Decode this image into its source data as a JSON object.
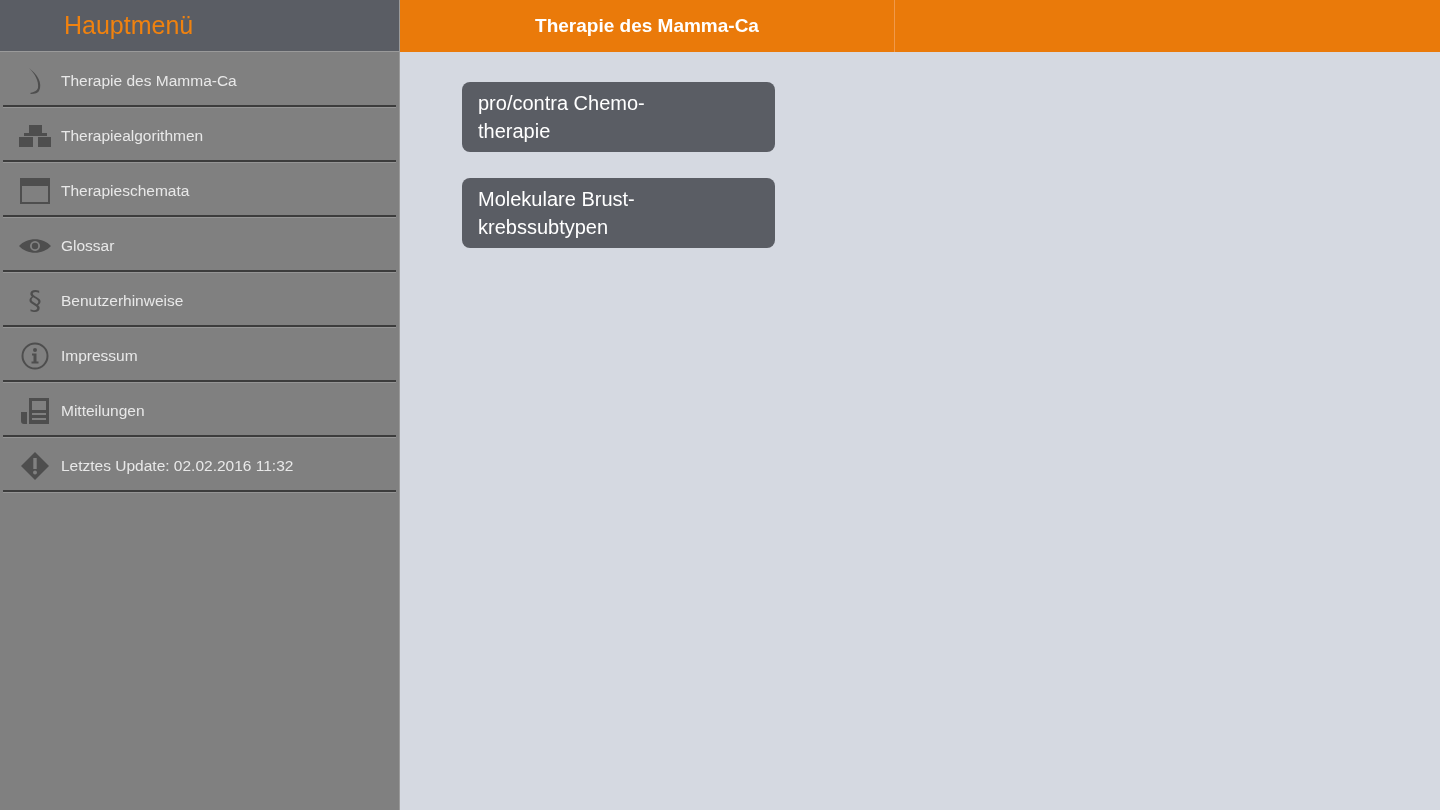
{
  "sidebar": {
    "title": "Hauptmenü",
    "items": [
      {
        "label": "Therapie des Mamma-Ca"
      },
      {
        "label": "Therapiealgorithmen"
      },
      {
        "label": "Therapieschemata"
      },
      {
        "label": "Glossar"
      },
      {
        "label": "Benutzerhinweise",
        "symbol": "§"
      },
      {
        "label": "Impressum"
      },
      {
        "label": "Mitteilungen"
      },
      {
        "label": "Letztes Update: 02.02.2016 11:32"
      }
    ]
  },
  "header": {
    "title": "Therapie des Mamma-Ca"
  },
  "tiles": [
    {
      "label": "pro/contra Chemo-\ntherapie"
    },
    {
      "label": "Molekulare Brust-\nkrebssubtypen"
    }
  ]
}
